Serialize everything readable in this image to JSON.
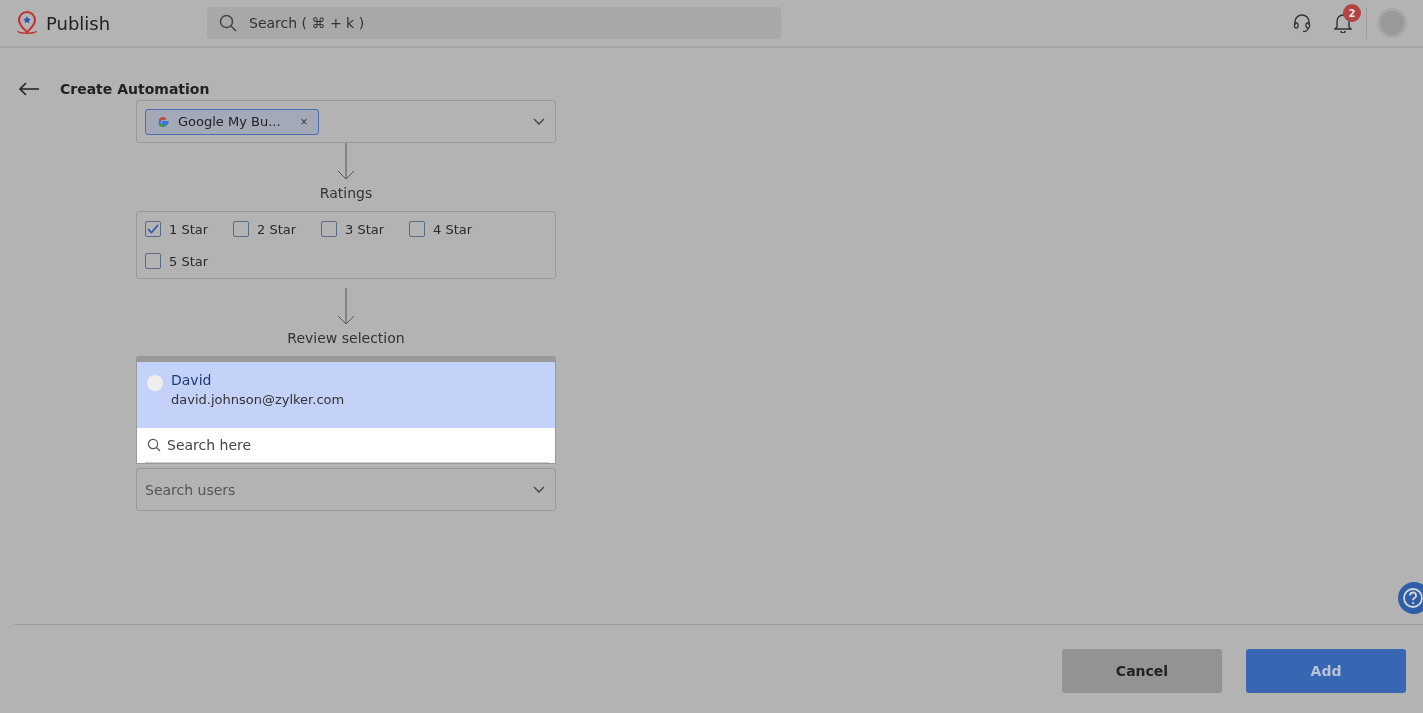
{
  "app": {
    "name": "Publish",
    "search_placeholder": "Search ( ⌘ + k )",
    "notification_count": "2"
  },
  "page": {
    "title": "Create Automation"
  },
  "source": {
    "chip_label": "Google My Bu...",
    "remove_glyph": "×"
  },
  "ratings": {
    "label": "Ratings",
    "options": [
      {
        "label": "1 Star",
        "checked": true
      },
      {
        "label": "2 Star",
        "checked": false
      },
      {
        "label": "3 Star",
        "checked": false
      },
      {
        "label": "4 Star",
        "checked": false
      },
      {
        "label": "5 Star",
        "checked": false
      }
    ]
  },
  "review": {
    "label": "Review selection",
    "users": [
      {
        "name": "David",
        "email": "david.johnson@zylker.com",
        "selected": true
      }
    ],
    "search_placeholder": "Search here"
  },
  "users_field": {
    "placeholder": "Search users"
  },
  "buttons": {
    "cancel": "Cancel",
    "add": "Add"
  }
}
